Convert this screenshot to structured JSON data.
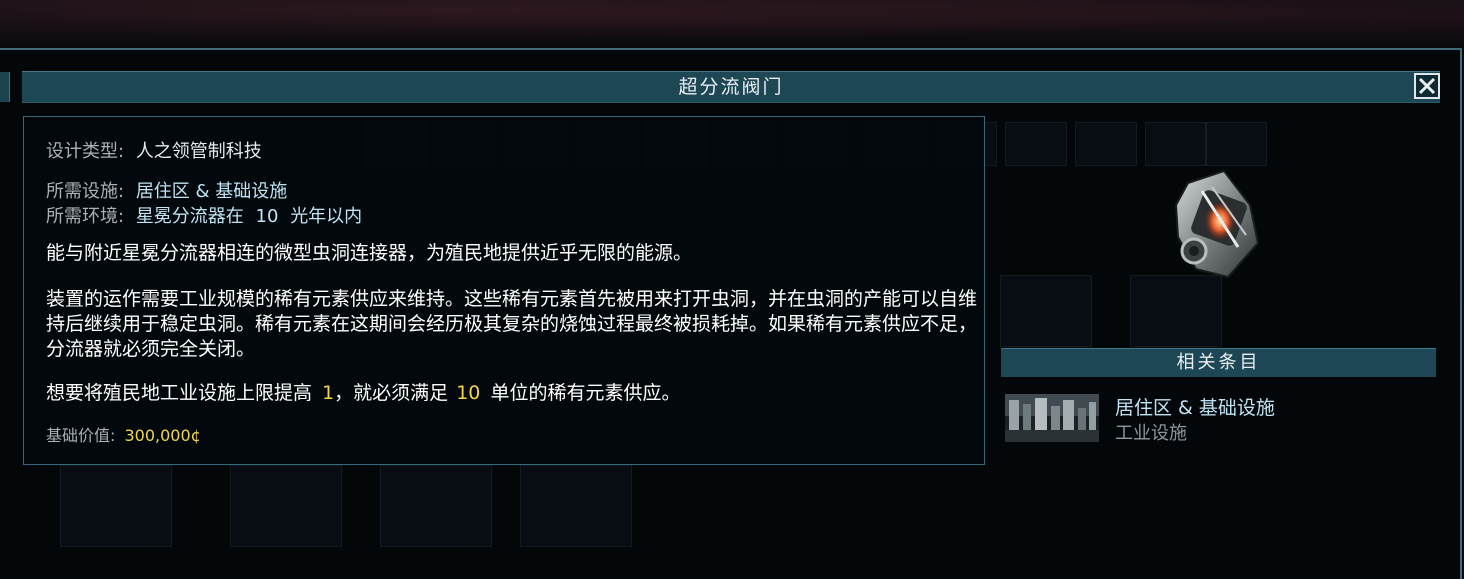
{
  "window": {
    "title": "超分流阀门"
  },
  "info": {
    "design_type_label": "设计类型:",
    "design_type_value": "人之领管制科技",
    "required_facility_label": "所需设施:",
    "required_facility_value": "居住区 & 基础设施",
    "required_env_label": "所需环境:",
    "required_env_value_a": "星冕分流器在",
    "required_env_value_num": "10",
    "required_env_value_b": "光年以内",
    "para1": "能与附近星冕分流器相连的微型虫洞连接器，为殖民地提供近乎无限的能源。",
    "para2": "装置的运作需要工业规模的稀有元素供应来维持。这些稀有元素首先被用来打开虫洞，并在虫洞的产能可以自维持后继续用于稳定虫洞。稀有元素在这期间会经历极其复杂的烧蚀过程最终被损耗掉。如果稀有元素供应不足，分流器就必须完全关闭。",
    "para3_a": "想要将殖民地工业设施上限提高",
    "para3_num1": "1",
    "para3_b": "，就必须满足",
    "para3_num2": "10",
    "para3_c": "单位的稀有元素供应。",
    "base_value_label": "基础价值:",
    "base_value": "300,000¢"
  },
  "related": {
    "header": "相关条目",
    "items": [
      {
        "title": "居住区 & 基础设施",
        "subtitle": "工业设施",
        "icon": "infrastructure-thumbnail"
      }
    ]
  },
  "icons": {
    "close": "close-icon",
    "item": "flux-valve-icon"
  },
  "colors": {
    "title_bar": "#1e4756",
    "panel_border": "#3a6878",
    "highlight_yellow": "#f3d64a",
    "link_blue": "#bfe3f3",
    "label_gray": "#a9b1b5"
  }
}
